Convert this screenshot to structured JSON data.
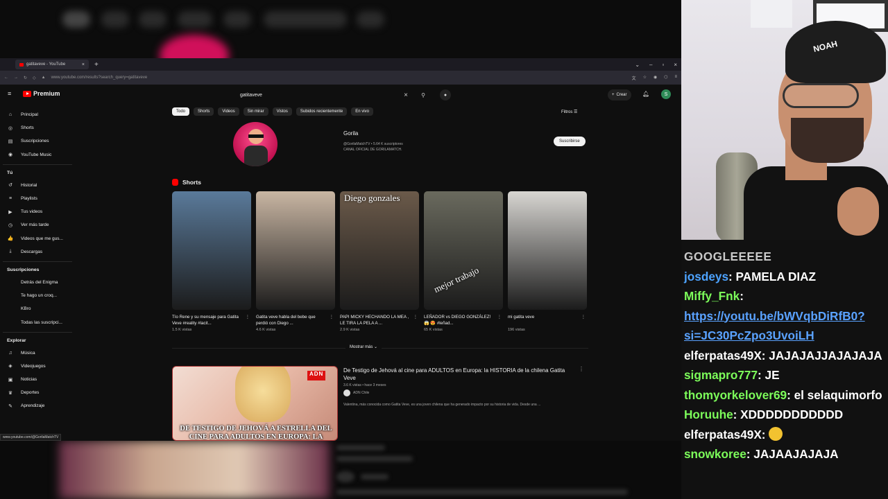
{
  "browser": {
    "tab_title": "gatitaveve - YouTube",
    "url": "www.youtube.com/results?search_query=gatitaveve"
  },
  "youtube": {
    "logo_label": "Premium",
    "search_value": "gatitaveve",
    "crear_label": "Crear",
    "avatar_letter": "S",
    "sidebar": {
      "main": [
        {
          "icon": "home-icon",
          "glyph": "⌂",
          "label": "Principal"
        },
        {
          "icon": "shorts-icon",
          "glyph": "◎",
          "label": "Shorts"
        },
        {
          "icon": "subscriptions-icon",
          "glyph": "▤",
          "label": "Suscripciones"
        },
        {
          "icon": "youtube-music-icon",
          "glyph": "◉",
          "label": "YouTube Music"
        }
      ],
      "you_heading": "Tú",
      "you": [
        {
          "icon": "history-icon",
          "glyph": "↺",
          "label": "Historial"
        },
        {
          "icon": "playlists-icon",
          "glyph": "≡",
          "label": "Playlists"
        },
        {
          "icon": "your-videos-icon",
          "glyph": "▶",
          "label": "Tus videos"
        },
        {
          "icon": "watch-later-icon",
          "glyph": "◷",
          "label": "Ver más tarde"
        },
        {
          "icon": "liked-videos-icon",
          "glyph": "👍",
          "label": "Videos que me gus..."
        },
        {
          "icon": "downloads-icon",
          "glyph": "⤓",
          "label": "Descargas"
        }
      ],
      "subs_heading": "Suscripciones",
      "subs": [
        {
          "icon": "channel-avatar-icon",
          "label": "Detrás del Enigma"
        },
        {
          "icon": "channel-avatar-icon",
          "label": "Te hago un croq..."
        },
        {
          "icon": "channel-avatar-icon",
          "label": "KBro"
        },
        {
          "icon": "all-subscriptions-icon",
          "label": "Todas las suscripci..."
        }
      ],
      "explore_heading": "Explorar",
      "explore": [
        {
          "icon": "music-icon",
          "glyph": "♫",
          "label": "Música"
        },
        {
          "icon": "gaming-icon",
          "glyph": "◈",
          "label": "Videojuegos"
        },
        {
          "icon": "news-icon",
          "glyph": "▣",
          "label": "Noticias"
        },
        {
          "icon": "sports-icon",
          "glyph": "♛",
          "label": "Deportes"
        },
        {
          "icon": "learning-icon",
          "glyph": "✎",
          "label": "Aprendizaje"
        }
      ]
    },
    "chips": [
      "Todo",
      "Shorts",
      "Videos",
      "Sin mirar",
      "Vistos",
      "Subidos recientemente",
      "En vivo"
    ],
    "filters_label": "Filtros",
    "channel": {
      "name": "Gorila",
      "handle_line": "@GorilaMatchTV • 5.64 K suscriptores",
      "desc": "CANAL OFICIAL DE GORILAMATCH.",
      "subscribe_label": "Suscribirse"
    },
    "shorts_heading": "Shorts",
    "shorts": [
      {
        "title": "Tío Rene y su mensaje para Gatita Veve #reality #lacit...",
        "views": "1.5 K vistas",
        "bg": "#5a7a9a",
        "overlay": ""
      },
      {
        "title": "Gatita veve habla del bebe que perdió con Diego ...",
        "views": "4.6 K vistas",
        "bg": "#c9b6a3",
        "overlay": ""
      },
      {
        "title": "PAPI MICKY HECHANDO LA MEA , LE TIRA LA PELA A ...",
        "views": "2.9 K vistas",
        "bg": "#6b5a4a",
        "overlay": "Diego gonzales"
      },
      {
        "title": "LEÑADOR vs DIEGO GONZÁLEZ! 😱 😍 #leñad...",
        "views": "65 K vistas",
        "bg": "#6a6a5e",
        "overlay": "mejor trabajo"
      },
      {
        "title": "mi gatita veve",
        "views": "196 vistas",
        "bg": "#d8d6d2",
        "overlay": ""
      }
    ],
    "show_more": "Mostrar más",
    "video": {
      "title": "De Testigo de Jehová al cine para ADULTOS en Europa: la HISTORIA de la chilena Gatita Veve",
      "meta": "3.6 K vistas • hace 3 meses",
      "channel": "ADN Chile",
      "desc": "Valentina, más conocida como Gatita Veve, es una joven chilena que ha generado impacto por su historia de vida. Desde una ...",
      "thumb_caption": "DE TESTIGO DE JEHOVÁ A ESTRELLA DEL CINE PARA ADULTOS EN EUROPA: LA",
      "thumb_badge": "ADN"
    },
    "status_url": "www.youtube.com/@GorilaMatchTV"
  },
  "webcam": {
    "beanie_text": "NOAH"
  },
  "chat": {
    "topic": "GOOGLEEEEE",
    "messages": [
      {
        "user": "josdeys",
        "color": "#4da3ff",
        "text": "PAMELA DIAZ",
        "link": ""
      },
      {
        "user": "Miffy_Fnk",
        "color": "#7cfc5a",
        "text": "",
        "link": "https://youtu.be/bWVqbDiRfB0?si=JC30PcZpo3UvoiLH"
      },
      {
        "user": "elferpatas49X",
        "color": "#ffffff",
        "text": "JAJAJAJJAJAJAJA",
        "link": ""
      },
      {
        "user": "sigmapro777",
        "color": "#7cfc5a",
        "text": "JE",
        "link": ""
      },
      {
        "user": "thomyorkelover69",
        "color": "#7cfc5a",
        "text": "el selaquimorfo",
        "link": ""
      },
      {
        "user": "Horuuhe",
        "color": "#7cfc5a",
        "text": "XDDDDDDDDDDD",
        "link": ""
      },
      {
        "user": "elferpatas49X",
        "color": "#ffffff",
        "text": "",
        "link": "",
        "emote": "thinking-emote-icon"
      },
      {
        "user": "snowkoree",
        "color": "#7cfc5a",
        "text": "JAJAAJAJAJA",
        "link": ""
      }
    ]
  }
}
